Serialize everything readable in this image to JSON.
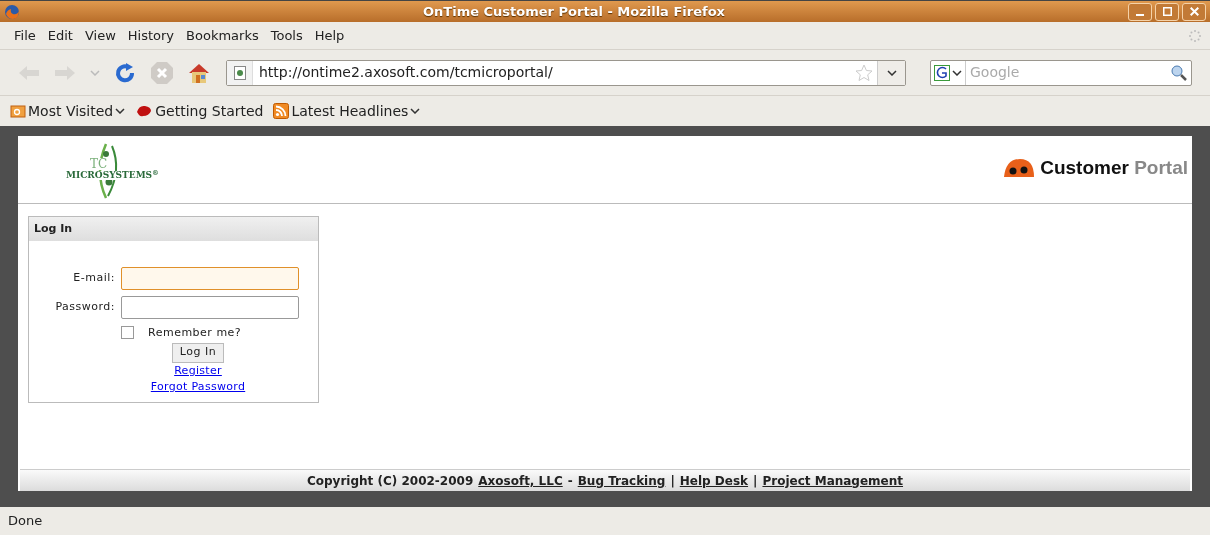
{
  "window": {
    "title": "OnTime Customer Portal - Mozilla Firefox"
  },
  "menu": [
    "File",
    "Edit",
    "View",
    "History",
    "Bookmarks",
    "Tools",
    "Help"
  ],
  "address_bar": {
    "url": "http://ontime2.axosoft.com/tcmicroportal/"
  },
  "search": {
    "placeholder": "Google"
  },
  "bookmarks": [
    {
      "label": "Most Visited",
      "kind": "folder"
    },
    {
      "label": "Getting Started",
      "kind": "page"
    },
    {
      "label": "Latest Headlines",
      "kind": "feed"
    }
  ],
  "page": {
    "logo": {
      "top": "TC",
      "main": "MICROSYSTEMS",
      "mark": "®"
    },
    "header": {
      "bold": "Customer",
      "light": "Portal"
    },
    "login": {
      "title": "Log In",
      "email_label": "E-mail:",
      "password_label": "Password:",
      "email_focused": true,
      "remember": {
        "label": "Remember me?",
        "checked": false
      },
      "button": "Log In",
      "links": [
        "Register",
        "Forgot Password"
      ]
    },
    "footer": [
      {
        "kind": "text",
        "text": "Copyright (C) 2002-2009"
      },
      {
        "kind": "link",
        "text": "Axosoft, LLC"
      },
      {
        "kind": "text",
        "text": "-"
      },
      {
        "kind": "link",
        "text": "Bug Tracking"
      },
      {
        "kind": "text",
        "text": "|"
      },
      {
        "kind": "link",
        "text": "Help Desk"
      },
      {
        "kind": "text",
        "text": "|"
      },
      {
        "kind": "link",
        "text": "Project Management"
      }
    ]
  },
  "status_bar": "Done"
}
